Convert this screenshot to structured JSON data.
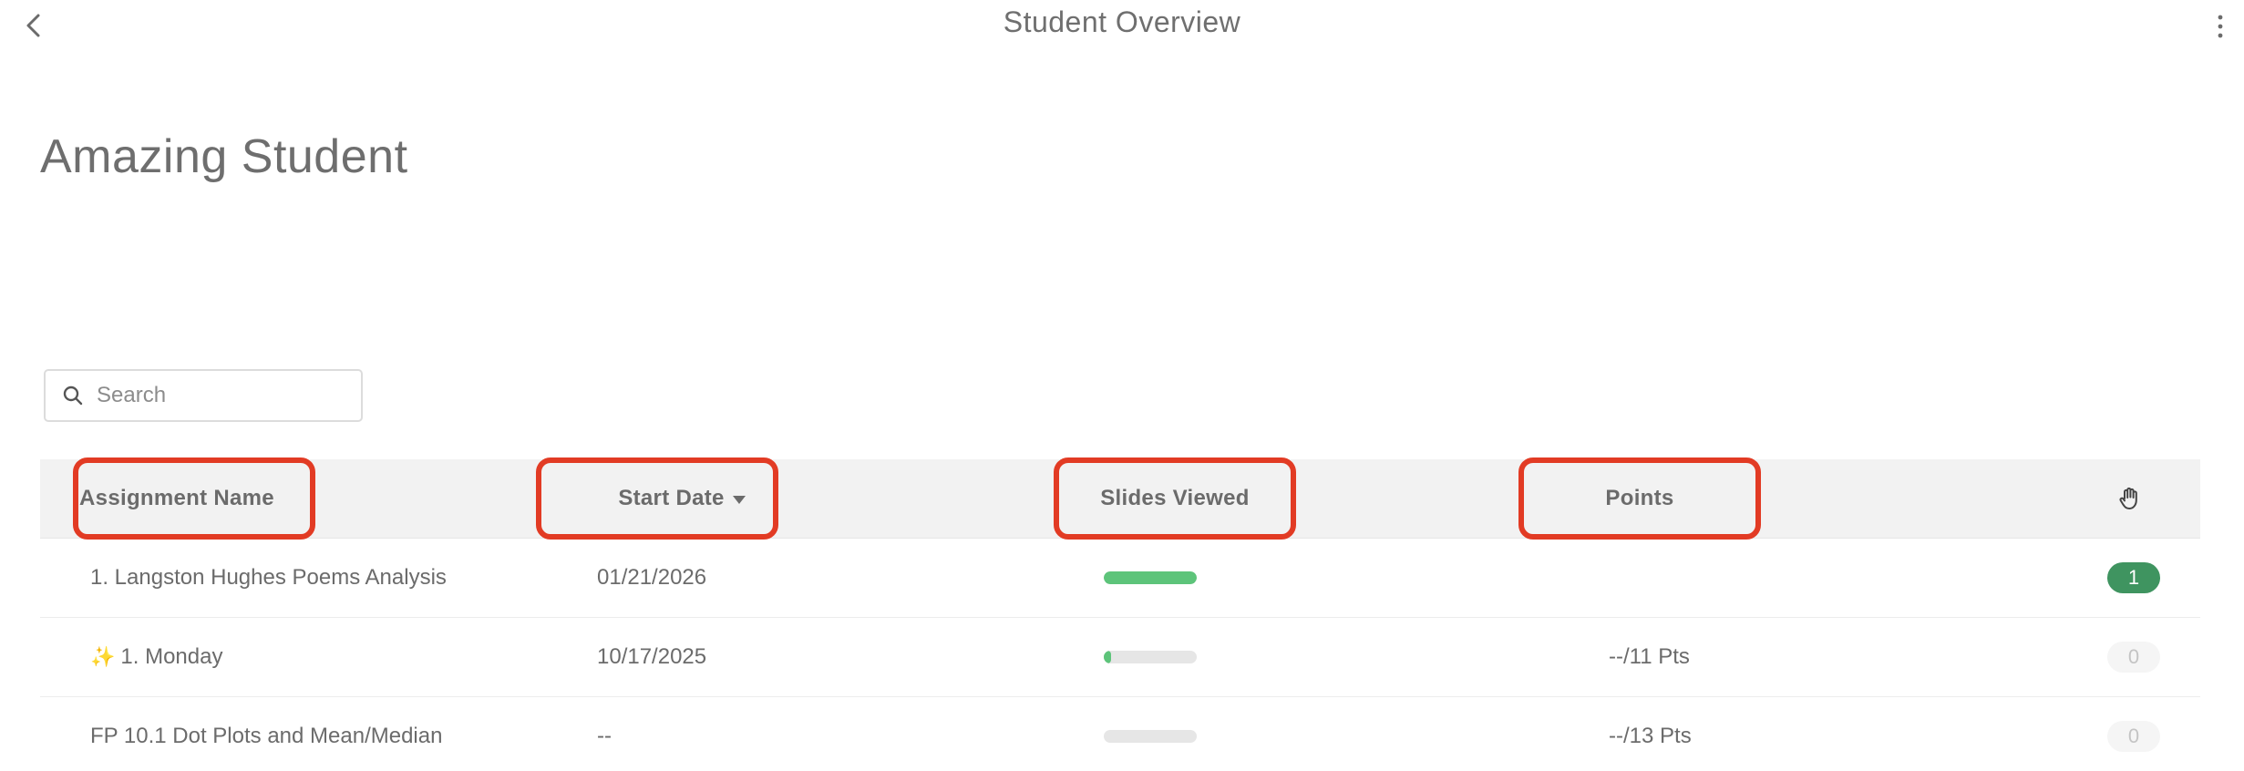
{
  "header": {
    "title": "Student Overview"
  },
  "student": {
    "name": "Amazing Student"
  },
  "search": {
    "placeholder": "Search",
    "value": ""
  },
  "table": {
    "columns": {
      "assignment_name": "Assignment Name",
      "start_date": "Start Date",
      "slides_viewed": "Slides Viewed",
      "points": "Points"
    },
    "rows": [
      {
        "name": "1. Langston Hughes Poems Analysis",
        "sparkle": "",
        "start_date": "01/21/2026",
        "slides_viewed_fraction": 1.0,
        "points": "",
        "badge": "1"
      },
      {
        "name": "1. Monday",
        "sparkle": "✨",
        "start_date": "10/17/2025",
        "slides_viewed_fraction": 0.08,
        "points": "--/11 Pts",
        "badge": "0"
      },
      {
        "name": "FP 10.1 Dot Plots and Mean/Median",
        "sparkle": "",
        "start_date": "--",
        "slides_viewed_fraction": 0.0,
        "points": "--/13 Pts",
        "badge": "0"
      }
    ]
  },
  "colors": {
    "highlight": "#e23b24",
    "progress": "#5dc47a",
    "badge_active": "#3f9460"
  }
}
